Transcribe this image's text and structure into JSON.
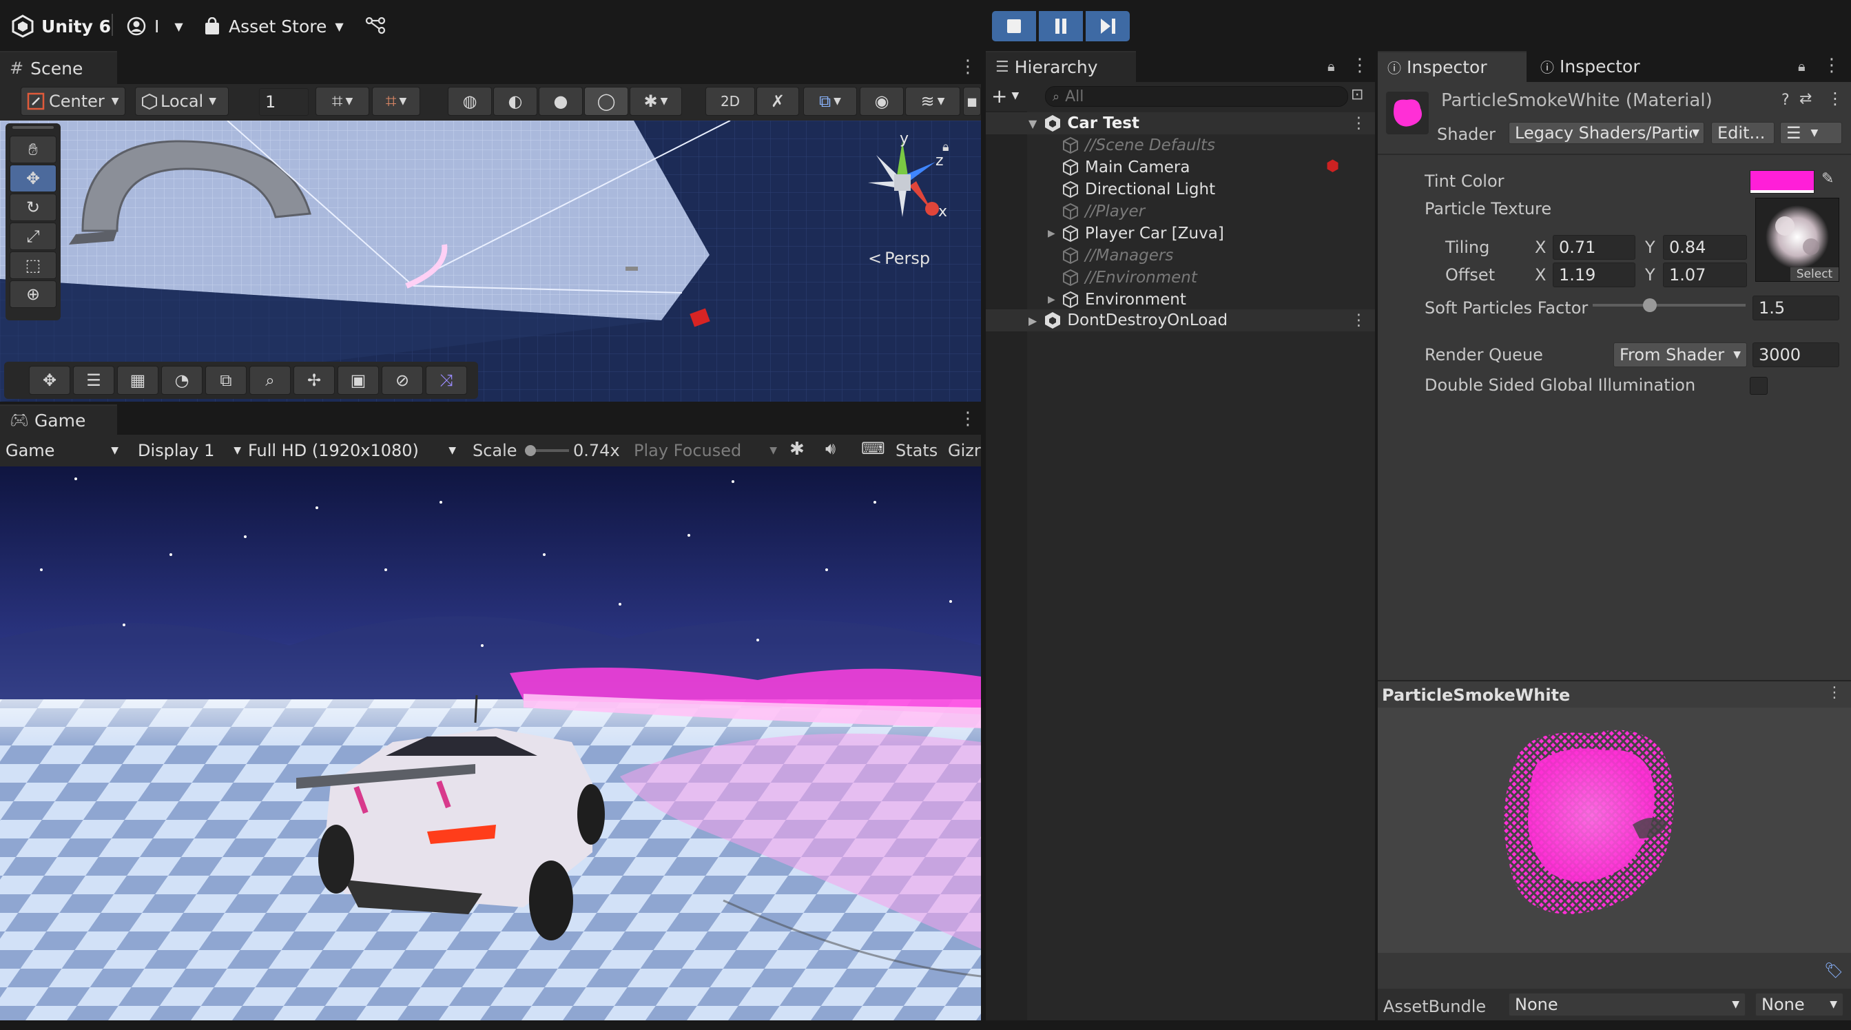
{
  "topbar": {
    "product": "Unity 6",
    "account_caret": "I",
    "asset_store": "Asset Store"
  },
  "scene": {
    "tab": "Scene",
    "pivot": "Center",
    "space": "Local",
    "grid_value": "1",
    "gizmo_y": "y",
    "gizmo_z": "z",
    "gizmo_x": "x",
    "projection": "Persp"
  },
  "game": {
    "tab": "Game",
    "mode": "Game",
    "display": "Display 1",
    "resolution": "Full HD (1920x1080)",
    "scale_label": "Scale",
    "scale_value": "0.74x",
    "play_focused": "Play Focused",
    "stats": "Stats",
    "gizmos": "Gizr"
  },
  "hierarchy": {
    "tab": "Hierarchy",
    "search_placeholder": "All",
    "scene_name": "Car Test",
    "items": [
      {
        "label": "//Scene Defaults",
        "dim": true
      },
      {
        "label": "Main Camera",
        "dim": false
      },
      {
        "label": "Directional Light",
        "dim": false
      },
      {
        "label": "//Player",
        "dim": true
      },
      {
        "label": "Player Car [Zuva]",
        "dim": false
      },
      {
        "label": "//Managers",
        "dim": true
      },
      {
        "label": "//Environment",
        "dim": true
      },
      {
        "label": "Environment",
        "dim": false
      }
    ],
    "ddol": "DontDestroyOnLoad"
  },
  "inspector": {
    "tab1": "Inspector",
    "tab2": "Inspector",
    "material_name": "ParticleSmokeWhite (Material)",
    "shader_label": "Shader",
    "shader_value": "Legacy Shaders/Partic",
    "edit_button": "Edit...",
    "tint_color_label": "Tint Color",
    "tint_color": "#ff1fd8",
    "particle_texture_label": "Particle Texture",
    "tiling_label": "Tiling",
    "offset_label": "Offset",
    "x_label": "X",
    "y_label": "Y",
    "tiling_x": "0.71",
    "tiling_y": "0.84",
    "offset_x": "1.19",
    "offset_y": "1.07",
    "select_label": "Select",
    "soft_particles_label": "Soft Particles Factor",
    "soft_particles_value": "1.5",
    "soft_particles_fraction": 0.36,
    "render_queue_label": "Render Queue",
    "render_queue_mode": "From Shader",
    "render_queue_value": "3000",
    "double_sided_label": "Double Sided Global Illumination",
    "preview_title": "ParticleSmokeWhite",
    "assetbundle_label": "AssetBundle",
    "assetbundle_value": "None",
    "assetbundle_variant": "None"
  },
  "colors": {
    "accent_play": "#3e6aa4",
    "magenta": "#ff2fd6",
    "panel_bg": "#383838",
    "sky": "#1d2557"
  }
}
